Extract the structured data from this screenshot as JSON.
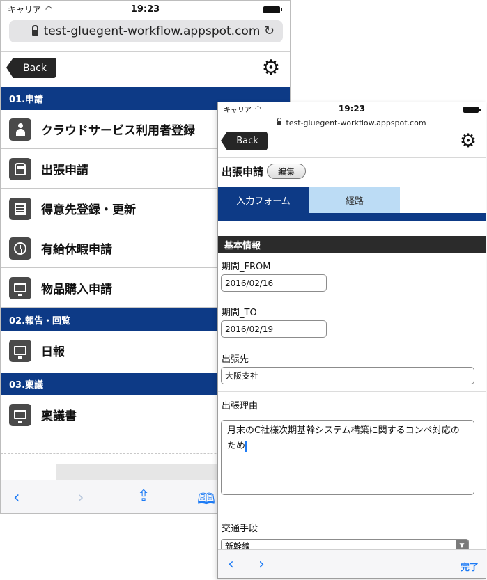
{
  "back_screen": {
    "status": {
      "carrier": "キャリア",
      "time": "19:23"
    },
    "url": "test-gluegent-workflow.appspot.com",
    "back_label": "Back",
    "sections": [
      {
        "title": "01.申請",
        "items": [
          {
            "label": "クラウドサービス利用者登録",
            "icon": "person-icon"
          },
          {
            "label": "出張申請",
            "icon": "train-icon"
          },
          {
            "label": "得意先登録・更新",
            "icon": "building-icon"
          },
          {
            "label": "有給休暇申請",
            "icon": "clock-icon"
          },
          {
            "label": "物品購入申請",
            "icon": "monitor-icon"
          }
        ]
      },
      {
        "title": "02.報告・回覧",
        "items": [
          {
            "label": "日報",
            "icon": "monitor-icon"
          }
        ]
      },
      {
        "title": "03.稟議",
        "items": [
          {
            "label": "稟議書",
            "icon": "monitor-icon"
          }
        ]
      }
    ]
  },
  "front_screen": {
    "status": {
      "carrier": "キャリア",
      "time": "19:23"
    },
    "url": "test-gluegent-workflow.appspot.com",
    "back_label": "Back",
    "form_title": "出張申請",
    "edit_label": "編集",
    "tabs": [
      {
        "label": "入力フォーム",
        "active": true
      },
      {
        "label": "経路",
        "active": false
      }
    ],
    "section_title": "基本情報",
    "fields": {
      "period_from": {
        "label": "期間_FROM",
        "value": "2016/02/16"
      },
      "period_to": {
        "label": "期間_TO",
        "value": "2016/02/19"
      },
      "destination": {
        "label": "出張先",
        "value": "大阪支社"
      },
      "reason": {
        "label": "出張理由",
        "value_line1": "月末のC社様次期基幹システム構築に関するコンペ対応の",
        "value_line2": "ため"
      },
      "transport": {
        "label": "交通手段",
        "value": "新幹線"
      }
    },
    "done_label": "完了"
  },
  "colors": {
    "navy": "#0d3a86",
    "light_tab": "#bcdcf5",
    "ios_blue": "#1d7bf5"
  }
}
